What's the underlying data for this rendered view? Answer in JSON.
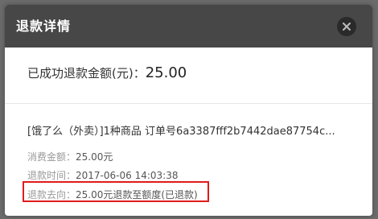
{
  "dialog": {
    "title": "退款详情",
    "close_icon": "close-icon"
  },
  "refund": {
    "amount_label": "已成功退款金额(元)：",
    "amount_value": "25.00"
  },
  "order": {
    "title": "[饿了么（外卖）]1种商品 订单号6a3387fff2b7442dae87754c..."
  },
  "details": {
    "consume_label": "消费金额：",
    "consume_value": "25.00元",
    "time_label": "退款时间：",
    "time_value": "2017-06-06 14:03:38",
    "destination_label": "退款去向：",
    "destination_value": "25.00元退款至额度(已退款)"
  },
  "colors": {
    "header_bg": "#474747",
    "highlight_border": "#e01b1b"
  }
}
